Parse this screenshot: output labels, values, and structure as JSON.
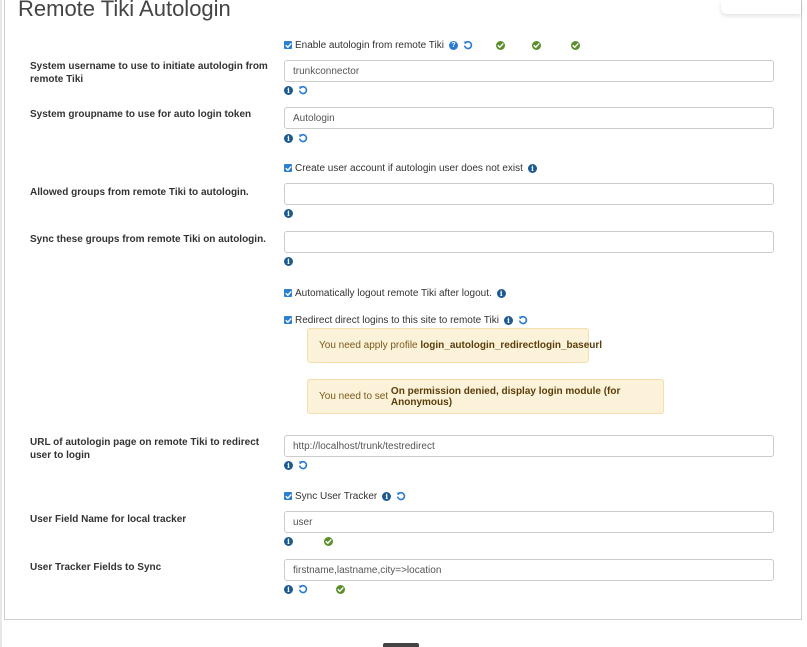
{
  "page": {
    "title": "Remote Tiki Autologin"
  },
  "enable_autologin": {
    "label": "Enable autologin from remote Tiki"
  },
  "fields": {
    "username": {
      "label": "System username to use to initiate autologin from remote Tiki",
      "value": "trunkconnector"
    },
    "groupname": {
      "label": "System groupname to use for auto login token",
      "value": "Autologin"
    },
    "allowed_groups": {
      "label": "Allowed groups from remote Tiki to autologin.",
      "value": ""
    },
    "sync_groups": {
      "label": "Sync these groups from remote Tiki on autologin.",
      "value": ""
    },
    "url": {
      "label": "URL of autologin page on remote Tiki to redirect user to login",
      "value": "http://localhost/trunk/testredirect"
    },
    "user_field": {
      "label": "User Field Name for local tracker",
      "value": "user"
    },
    "tracker_fields": {
      "label": "User Tracker Fields to Sync",
      "value": "firstname,lastname,city=>location"
    }
  },
  "checks": {
    "create_user": "Create user account if autologin user does not exist",
    "auto_logout": "Automatically logout remote Tiki after logout.",
    "redirect": "Redirect direct logins to this site to remote Tiki",
    "sync_tracker": "Sync User Tracker"
  },
  "warnings": {
    "w1_pre": "You need apply profile ",
    "w1_bold": "login_autologin_redirectlogin_baseurl",
    "w2_pre": "You need to set ",
    "w2_bold": "On permission denied, display login module (for Anonymous)"
  },
  "icons": {
    "info": "info-icon",
    "help": "help-icon",
    "reset": "reset-icon",
    "check": "check-icon"
  },
  "colors": {
    "checkbox": "#2f7fd1",
    "info": "#1e5a92",
    "check": "#5a8f2c",
    "warning_bg": "#fcf2d9"
  }
}
